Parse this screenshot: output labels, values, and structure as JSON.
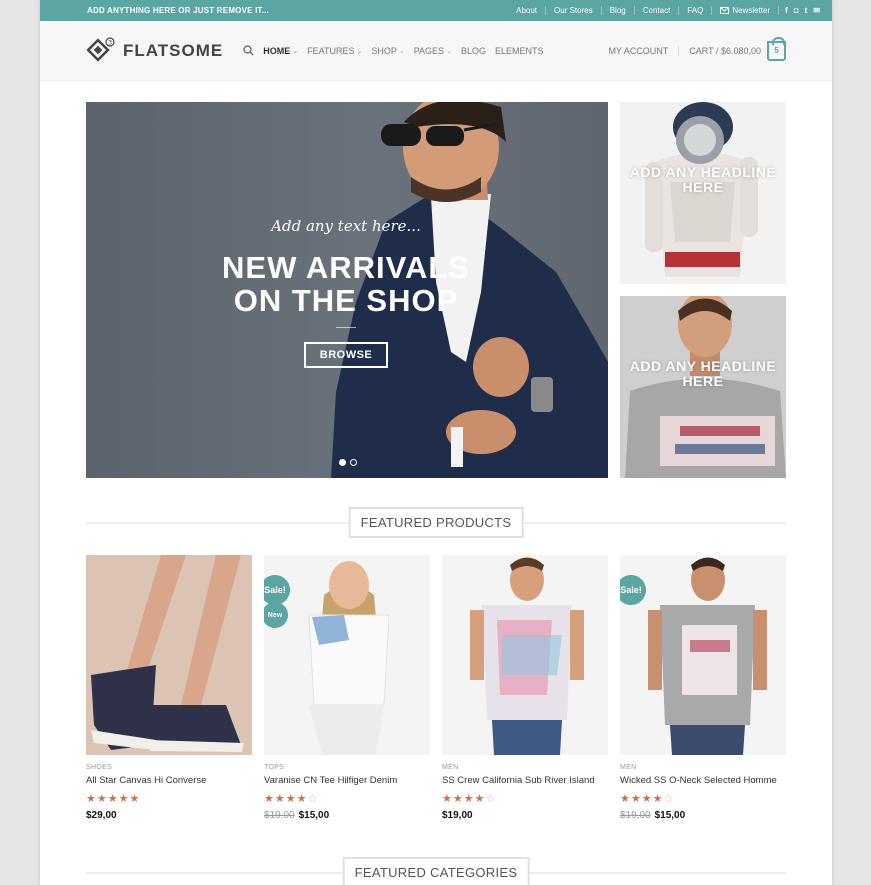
{
  "topbar": {
    "promo": "ADD ANYTHING HERE OR JUST REMOVE IT...",
    "links": [
      "About",
      "Our Stores",
      "Blog",
      "Contact",
      "FAQ"
    ],
    "newsletter": "Newsletter",
    "social": [
      "facebook-icon",
      "instagram-icon",
      "twitter-icon",
      "email-icon"
    ]
  },
  "header": {
    "logo": "FLATSOME",
    "nav": [
      {
        "label": "HOME",
        "caret": true,
        "active": true
      },
      {
        "label": "FEATURES",
        "caret": true
      },
      {
        "label": "SHOP",
        "caret": true
      },
      {
        "label": "PAGES",
        "caret": true
      },
      {
        "label": "BLOG",
        "caret": false
      },
      {
        "label": "ELEMENTS",
        "caret": false
      }
    ],
    "account": "MY ACCOUNT",
    "cart": "CART / $6.080,00",
    "cart_count": "5"
  },
  "hero": {
    "script": "Add any text here...",
    "title_line1": "NEW ARRIVALS",
    "title_line2": "ON THE SHOP",
    "button": "BROWSE"
  },
  "side_banners": [
    {
      "headline": "ADD ANY HEADLINE HERE"
    },
    {
      "headline": "ADD ANY HEADLINE HERE"
    }
  ],
  "sections": {
    "featured_products": "FEATURED PRODUCTS",
    "featured_categories": "FEATURED CATEGORIES"
  },
  "products": [
    {
      "category": "SHOES",
      "name": "All Star Canvas Hi Converse",
      "rating": 5,
      "price": "$29,00",
      "old_price": "",
      "badges": []
    },
    {
      "category": "TOPS",
      "name": "Varanise CN Tee Hilfiger Denim",
      "rating": 4,
      "price": "$15,00",
      "old_price": "$19,00",
      "badges": [
        "Sale!",
        "New"
      ]
    },
    {
      "category": "MEN",
      "name": "SS Crew California Sub River Island",
      "rating": 4,
      "price": "$19,00",
      "old_price": "",
      "badges": []
    },
    {
      "category": "MEN",
      "name": "Wicked SS O-Neck Selected Homme",
      "rating": 4,
      "price": "$15,00",
      "old_price": "$19,00",
      "badges": [
        "Sale!"
      ]
    }
  ],
  "colors": {
    "accent": "#5ba5a3",
    "star": "#d26e4b"
  }
}
